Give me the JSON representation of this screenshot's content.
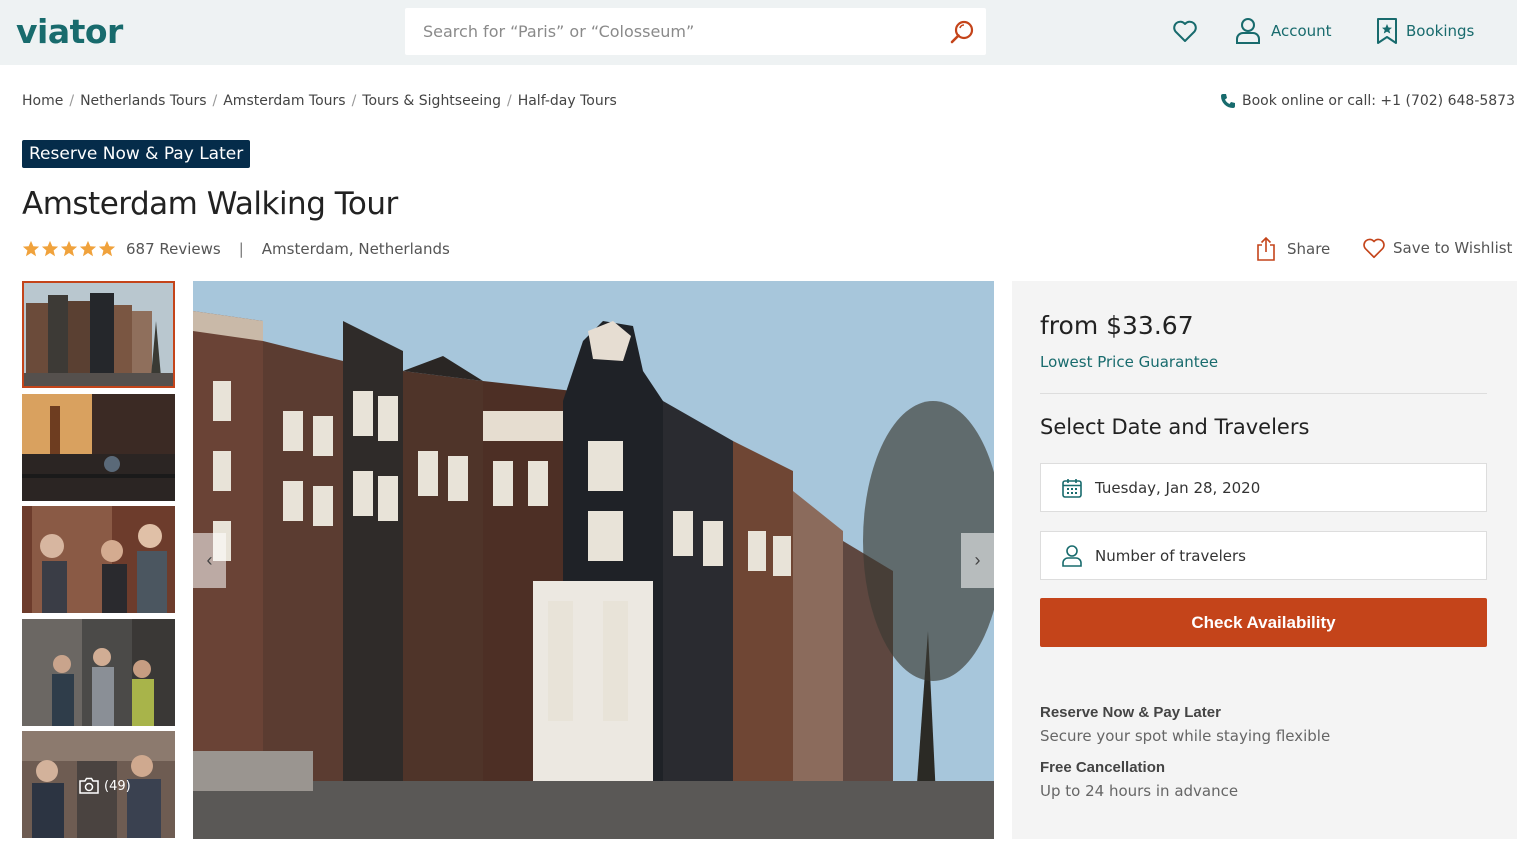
{
  "header": {
    "logo": "viator",
    "search_placeholder": "Search for “Paris” or “Colosseum”",
    "account_label": "Account",
    "bookings_label": "Bookings"
  },
  "breadcrumb": {
    "items": [
      "Home",
      "Netherlands Tours",
      "Amsterdam Tours",
      "Tours & Sightseeing",
      "Half-day Tours"
    ]
  },
  "phone": {
    "text": "Book online or call: +1 (702) 648-5873"
  },
  "product": {
    "badge": "Reserve Now & Pay Later",
    "title": "Amsterdam Walking Tour",
    "rating": 5,
    "reviews": "687 Reviews",
    "location": "Amsterdam, Netherlands",
    "share_label": "Share",
    "wishlist_label": "Save to Wishlist",
    "photo_count": "(49)"
  },
  "booking": {
    "price": "from $33.67",
    "guarantee": "Lowest Price Guarantee",
    "select_title": "Select Date and Travelers",
    "date_value": "Tuesday, Jan 28, 2020",
    "travelers_placeholder": "Number of travelers",
    "check_label": "Check Availability",
    "info": [
      {
        "title": "Reserve Now & Pay Later",
        "sub": "Secure your spot while staying flexible"
      },
      {
        "title": "Free Cancellation",
        "sub": "Up to 24 hours in advance"
      }
    ]
  },
  "colors": {
    "brand": "#186b6d",
    "accent": "#c4441a",
    "badge_bg": "#052c4a",
    "star": "#f0a23c"
  }
}
